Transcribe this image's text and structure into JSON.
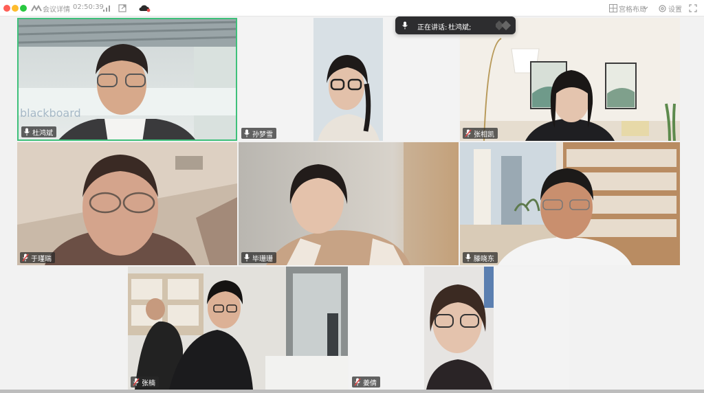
{
  "titlebar": {
    "meeting_info_label": "会议详情",
    "timer": "02:50:39",
    "layout_label": "宫格布局",
    "settings_label": "设置"
  },
  "speaking": {
    "prefix": "正在讲话:",
    "name": "杜鸿斌;"
  },
  "participants": [
    {
      "name": "杜鸿斌",
      "mic": "on",
      "active_speaker": true
    },
    {
      "name": "孙梦雪",
      "mic": "on"
    },
    {
      "name": "张相凯",
      "mic": "muted"
    },
    {
      "name": "于瑾瑞",
      "mic": "muted"
    },
    {
      "name": "毕珊珊",
      "mic": "on"
    },
    {
      "name": "滕晓东",
      "mic": "on"
    },
    {
      "name": "张楠",
      "mic": "muted"
    },
    {
      "name": "姜倩",
      "mic": "muted"
    }
  ],
  "backgrounds": {
    "wall_text": "blackboard"
  },
  "colors": {
    "active_border": "#3ec07a",
    "muted_slash": "#e24a4a",
    "close": "#ff5f57",
    "minimize": "#febc2e",
    "zoom": "#28c840"
  }
}
